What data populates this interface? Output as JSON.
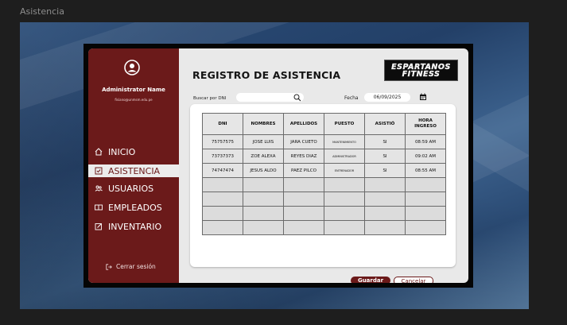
{
  "frame": {
    "label": "Asistencia"
  },
  "sidebar": {
    "admin_name": "Administrator Name",
    "admin_email": "fisiano@unmsm.edu.pe",
    "items": [
      {
        "label": "INICIO",
        "icon": "home-icon",
        "active": false
      },
      {
        "label": "ASISTENCIA",
        "icon": "checkbox-icon",
        "active": true
      },
      {
        "label": "USUARIOS",
        "icon": "users-icon",
        "active": false
      },
      {
        "label": "EMPLEADOS",
        "icon": "id-card-icon",
        "active": false
      },
      {
        "label": "INVENTARIO",
        "icon": "edit-icon",
        "active": false
      }
    ],
    "logout_label": "Cerrar sesión"
  },
  "main": {
    "title": "REGISTRO DE ASISTENCIA",
    "logo": {
      "line1": "ESPARTANOS",
      "line2": "FITNESS"
    },
    "search": {
      "label": "Buscar por DNI",
      "placeholder": ""
    },
    "date": {
      "label": "Fecha",
      "value": "06/09/2025"
    },
    "table": {
      "headers": [
        "DNI",
        "NOMBRES",
        "APELLIDOS",
        "PUESTO",
        "ASISTIÓ",
        "HORA INGRESO"
      ],
      "rows": [
        [
          "75757575",
          "JOSE LUIS",
          "JARA CUETO",
          "MANTENIMIENTO",
          "SI",
          "08:59 AM"
        ],
        [
          "73737373",
          "ZOE ALEXA",
          "REYES DIAZ",
          "ADMINISTRADOR",
          "SI",
          "09:02 AM"
        ],
        [
          "74747474",
          "JESUS ALDO",
          "PAEZ PILCO",
          "ENTRENADOR",
          "SI",
          "08:55 AM"
        ]
      ],
      "empty_rows": 4
    },
    "save_label": "Guardar",
    "cancel_label": "Cancelar"
  },
  "colors": {
    "brand": "#6b1a1a",
    "background": "#e9e9e9"
  }
}
